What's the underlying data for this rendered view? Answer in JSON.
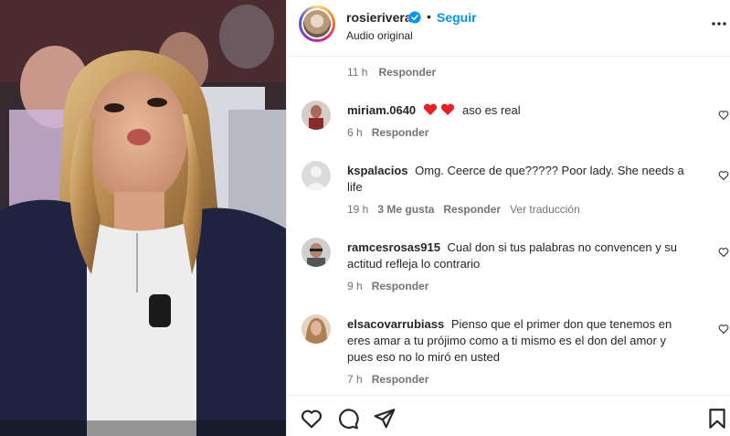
{
  "post": {
    "username": "rosierivera",
    "follow_label": "Seguir",
    "dot": "•",
    "audio": "Audio original"
  },
  "previous_meta": {
    "time": "11 h",
    "reply": "Responder"
  },
  "comments": [
    {
      "user": "miriam.0640",
      "text": "aso es real",
      "time": "6 h",
      "likes": "",
      "reply": "Responder",
      "translate": ""
    },
    {
      "user": "kspalacios",
      "text": "Omg. Ceerce de que????? Poor lady. She needs a life",
      "time": "19 h",
      "likes": "3 Me gusta",
      "reply": "Responder",
      "translate": "Ver traducción"
    },
    {
      "user": "ramcesrosas915",
      "text": "Cual don si tus palabras no convencen y su actitud refleja lo contrario",
      "time": "9 h",
      "likes": "",
      "reply": "Responder",
      "translate": ""
    },
    {
      "user": "elsacovarrubiass",
      "text": "Pienso que el primer don que tenemos en eres amar a tu prójimo como a ti mismo es el don del amor y pues eso no lo miró en usted",
      "time": "7 h",
      "likes": "",
      "reply": "Responder",
      "translate": ""
    }
  ],
  "colors": {
    "accent": "#0095f6",
    "verified": "#0095f6",
    "heart_red": "#ed1c24"
  }
}
